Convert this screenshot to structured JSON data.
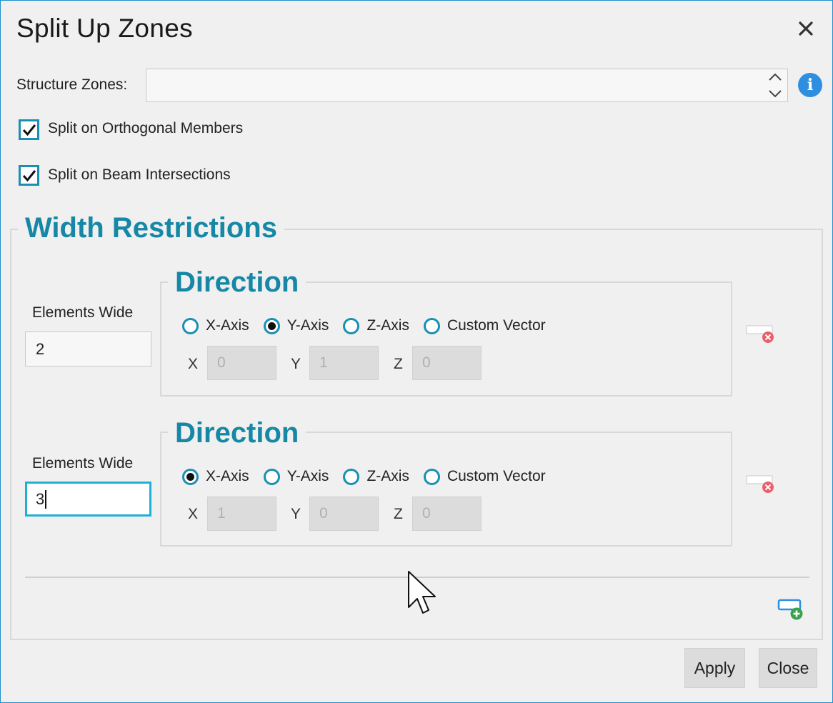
{
  "dialog": {
    "title": "Split Up Zones",
    "close_icon": "close-icon"
  },
  "structure_zones": {
    "label": "Structure Zones:",
    "value": "",
    "info_icon": "i"
  },
  "options": {
    "split_orthogonal": {
      "label": "Split on Orthogonal Members",
      "checked": true
    },
    "split_beam": {
      "label": "Split on Beam Intersections",
      "checked": true
    }
  },
  "width_restrictions": {
    "title": "Width Restrictions",
    "rows": [
      {
        "elements_wide_label": "Elements Wide",
        "elements_wide_value": "2",
        "direction_title": "Direction",
        "axes": [
          "X-Axis",
          "Y-Axis",
          "Z-Axis",
          "Custom Vector"
        ],
        "selected_axis": "Y-Axis",
        "coord_labels": [
          "X",
          "Y",
          "Z"
        ],
        "coords": [
          "0",
          "1",
          "0"
        ]
      },
      {
        "elements_wide_label": "Elements Wide",
        "elements_wide_value": "3",
        "direction_title": "Direction",
        "axes": [
          "X-Axis",
          "Y-Axis",
          "Z-Axis",
          "Custom Vector"
        ],
        "selected_axis": "X-Axis",
        "coord_labels": [
          "X",
          "Y",
          "Z"
        ],
        "coords": [
          "1",
          "0",
          "0"
        ]
      }
    ]
  },
  "footer": {
    "apply_label": "Apply",
    "close_label": "Close"
  },
  "colors": {
    "accent": "#1688a6",
    "focus_border": "#1fb0d8",
    "info": "#2e8fe0",
    "delete_badge": "#e8606a",
    "add_badge": "#3aa24a"
  }
}
